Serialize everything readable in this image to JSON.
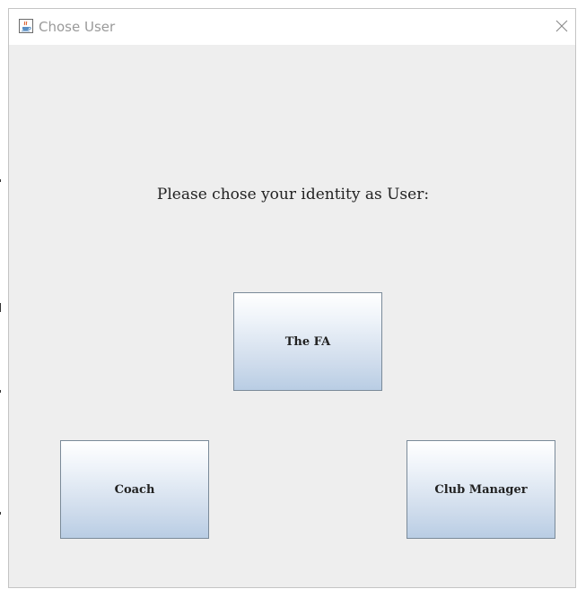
{
  "window": {
    "title": "Chose User",
    "icon": "java-cup-icon"
  },
  "prompt": "Please chose your identity as User:",
  "buttons": {
    "fa": "The FA",
    "coach": "Coach",
    "club_manager": "Club Manager"
  },
  "colors": {
    "background": "#eeeeee",
    "button_gradient_top": "#ffffff",
    "button_gradient_bottom": "#b9cde4",
    "button_border": "#7a8a99"
  }
}
